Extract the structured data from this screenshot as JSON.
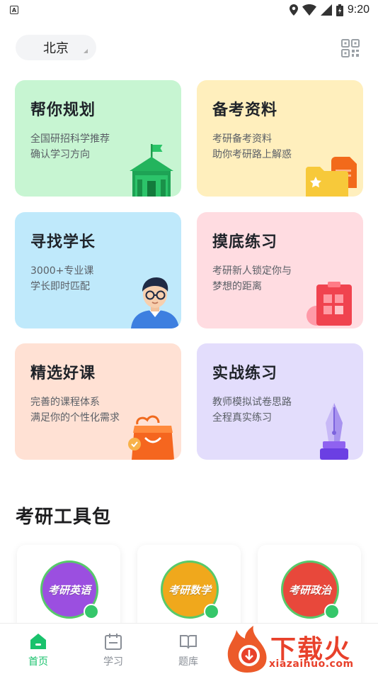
{
  "status_bar": {
    "time": "9:20",
    "left_badge": "A"
  },
  "header": {
    "city": "北京"
  },
  "cards": [
    {
      "title": "帮你规划",
      "line1": "全国研招科学推荐",
      "line2": "确认学习方向",
      "bg": "#c7f5d2"
    },
    {
      "title": "备考资料",
      "line1": "考研备考资料",
      "line2": "助你考研路上解惑",
      "bg": "#ffefbd"
    },
    {
      "title": "寻找学长",
      "line1": "3000+专业课",
      "line2": "学长即时匹配",
      "bg": "#bfe9fb"
    },
    {
      "title": "摸底练习",
      "line1": "考研新人锁定你与",
      "line2": "梦想的距离",
      "bg": "#ffdce1"
    },
    {
      "title": "精选好课",
      "line1": "完善的课程体系",
      "line2": "满足你的个性化需求",
      "bg": "#ffe1d4"
    },
    {
      "title": "实战练习",
      "line1": "教师模拟试卷思路",
      "line2": "全程真实练习",
      "bg": "#e3ddfc"
    }
  ],
  "toolbox": {
    "title": "考研工具包",
    "items": [
      {
        "label": "考研英语",
        "color": "#9b4fe0"
      },
      {
        "label": "考研数学",
        "color": "#f0a81c"
      },
      {
        "label": "考研政治",
        "color": "#e8483b"
      }
    ]
  },
  "bottom_nav": {
    "items": [
      {
        "label": "首页",
        "active": true
      },
      {
        "label": "学习",
        "active": false
      },
      {
        "label": "题库",
        "active": false
      }
    ]
  },
  "watermark": {
    "text": "下载火",
    "url": "xiazaihuo.com"
  },
  "colors": {
    "accent": "#19c26c",
    "watermark": "#e8412b"
  }
}
